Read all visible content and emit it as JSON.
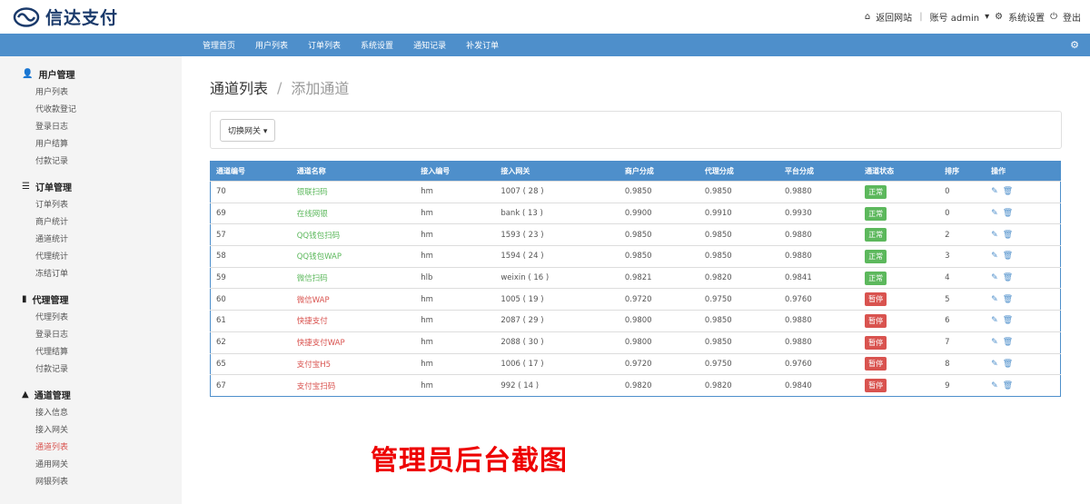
{
  "header": {
    "logo_text": "信达支付",
    "back_site": "返回网站",
    "account": "账号 admin",
    "settings": "系统设置",
    "logout": "登出"
  },
  "nav": [
    "管理首页",
    "用户列表",
    "订单列表",
    "系统设置",
    "通知记录",
    "补发订单"
  ],
  "sidebar": [
    {
      "title": "用户管理",
      "icon": "user-icon",
      "items": [
        "用户列表",
        "代收款登记",
        "登录日志",
        "用户结算",
        "付款记录"
      ]
    },
    {
      "title": "订单管理",
      "icon": "list-icon",
      "items": [
        "订单列表",
        "商户统计",
        "通道统计",
        "代理统计",
        "冻结订单"
      ]
    },
    {
      "title": "代理管理",
      "icon": "file-icon",
      "items": [
        "代理列表",
        "登录日志",
        "代理结算",
        "付款记录"
      ]
    },
    {
      "title": "通道管理",
      "icon": "road-icon",
      "items": [
        "接入信息",
        "接入网关",
        "通道列表",
        "通用网关",
        "网银列表"
      ]
    }
  ],
  "active_item": "通道列表",
  "breadcrumb": {
    "title": "通道列表",
    "sep": "/",
    "sub": "添加通道"
  },
  "switch_button": "切换网关",
  "table": {
    "headers": [
      "通道编号",
      "通道名称",
      "接入编号",
      "接入网关",
      "商户分成",
      "代理分成",
      "平台分成",
      "通道状态",
      "排序",
      "操作"
    ],
    "rows": [
      [
        "70",
        "银联扫码",
        "hm",
        "1007 ( 28 )",
        "0.9850",
        "0.9850",
        "0.9880",
        "正常",
        "0"
      ],
      [
        "69",
        "在线网银",
        "hm",
        "bank ( 13 )",
        "0.9900",
        "0.9910",
        "0.9930",
        "正常",
        "0"
      ],
      [
        "57",
        "QQ钱包扫码",
        "hm",
        "1593 ( 23 )",
        "0.9850",
        "0.9850",
        "0.9880",
        "正常",
        "2"
      ],
      [
        "58",
        "QQ钱包WAP",
        "hm",
        "1594 ( 24 )",
        "0.9850",
        "0.9850",
        "0.9880",
        "正常",
        "3"
      ],
      [
        "59",
        "微信扫码",
        "hlb",
        "weixin ( 16 )",
        "0.9821",
        "0.9820",
        "0.9841",
        "正常",
        "4"
      ],
      [
        "60",
        "微信WAP",
        "hm",
        "1005 ( 19 )",
        "0.9720",
        "0.9750",
        "0.9760",
        "暂停",
        "5"
      ],
      [
        "61",
        "快捷支付",
        "hm",
        "2087 ( 29 )",
        "0.9800",
        "0.9850",
        "0.9880",
        "暂停",
        "6"
      ],
      [
        "62",
        "快捷支付WAP",
        "hm",
        "2088 ( 30 )",
        "0.9800",
        "0.9850",
        "0.9880",
        "暂停",
        "7"
      ],
      [
        "65",
        "支付宝H5",
        "hm",
        "1006 ( 17 )",
        "0.9720",
        "0.9750",
        "0.9760",
        "暂停",
        "8"
      ],
      [
        "67",
        "支付宝扫码",
        "hm",
        "992 ( 14 )",
        "0.9820",
        "0.9820",
        "0.9840",
        "暂停",
        "9"
      ]
    ]
  },
  "watermark": "管理员后台截图",
  "colors": {
    "primary": "#4e8fcb",
    "success": "#5cb85c",
    "danger": "#d9534f"
  }
}
